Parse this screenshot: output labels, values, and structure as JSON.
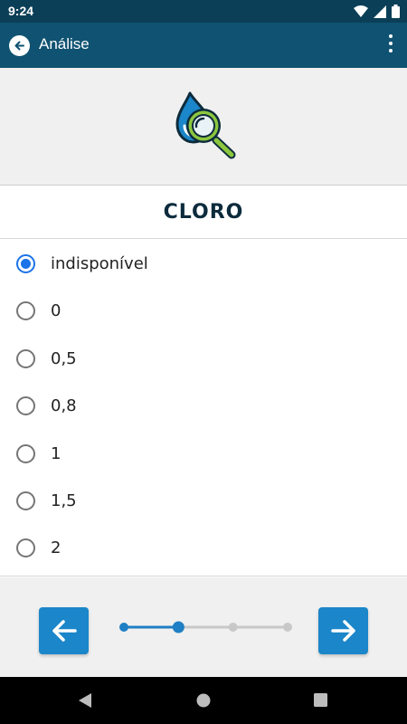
{
  "status_bar": {
    "time": "9:24"
  },
  "app_bar": {
    "title": "Análise"
  },
  "question": {
    "title": "CLORO"
  },
  "options": [
    {
      "label": "indisponível",
      "selected": true
    },
    {
      "label": "0",
      "selected": false
    },
    {
      "label": "0,5",
      "selected": false
    },
    {
      "label": "0,8",
      "selected": false
    },
    {
      "label": "1",
      "selected": false
    },
    {
      "label": "1,5",
      "selected": false
    },
    {
      "label": "2",
      "selected": false
    }
  ],
  "progress": {
    "current_step": 2,
    "total_steps": 4
  },
  "colors": {
    "app_bar": "#0f5271",
    "status_bar": "#0b3f57",
    "accent": "#1b86c9",
    "radio_selected": "#1a73e8"
  }
}
